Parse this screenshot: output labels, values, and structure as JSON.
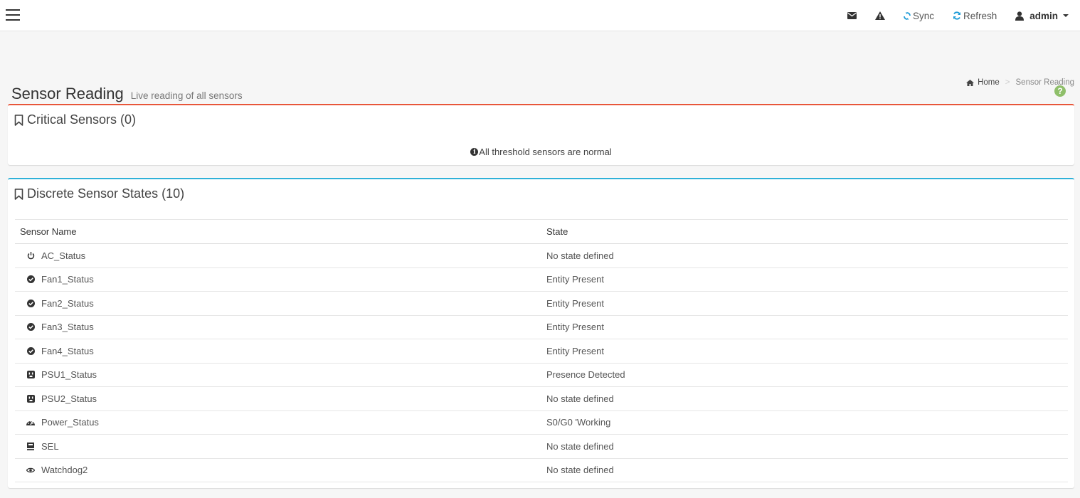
{
  "navbar": {
    "sync_label": "Sync",
    "refresh_label": "Refresh",
    "user_label": "admin",
    "accent_color": "#1e9bd7"
  },
  "header": {
    "title": "Sensor Reading",
    "subtitle": "Live reading of all sensors"
  },
  "breadcrumb": {
    "home": "Home",
    "separator": ">",
    "current": "Sensor Reading"
  },
  "critical": {
    "title": "Critical Sensors (0)",
    "message": "All threshold sensors are normal",
    "border_color": "#e8563a"
  },
  "discrete": {
    "title": "Discrete Sensor States (10)",
    "border_color": "#2fb1d8",
    "columns": [
      "Sensor Name",
      "State"
    ],
    "rows": [
      {
        "icon": "power-icon",
        "name": "AC_Status",
        "state": "No state defined"
      },
      {
        "icon": "check-circle-icon",
        "name": "Fan1_Status",
        "state": "Entity Present"
      },
      {
        "icon": "check-circle-icon",
        "name": "Fan2_Status",
        "state": "Entity Present"
      },
      {
        "icon": "check-circle-icon",
        "name": "Fan3_Status",
        "state": "Entity Present"
      },
      {
        "icon": "check-circle-icon",
        "name": "Fan4_Status",
        "state": "Entity Present"
      },
      {
        "icon": "plug-icon",
        "name": "PSU1_Status",
        "state": "Presence Detected"
      },
      {
        "icon": "plug-icon",
        "name": "PSU2_Status",
        "state": "No state defined"
      },
      {
        "icon": "dashboard-icon",
        "name": "Power_Status",
        "state": "S0/G0 'Working"
      },
      {
        "icon": "log-icon",
        "name": "SEL",
        "state": "No state defined"
      },
      {
        "icon": "eye-icon",
        "name": "Watchdog2",
        "state": "No state defined"
      }
    ]
  }
}
